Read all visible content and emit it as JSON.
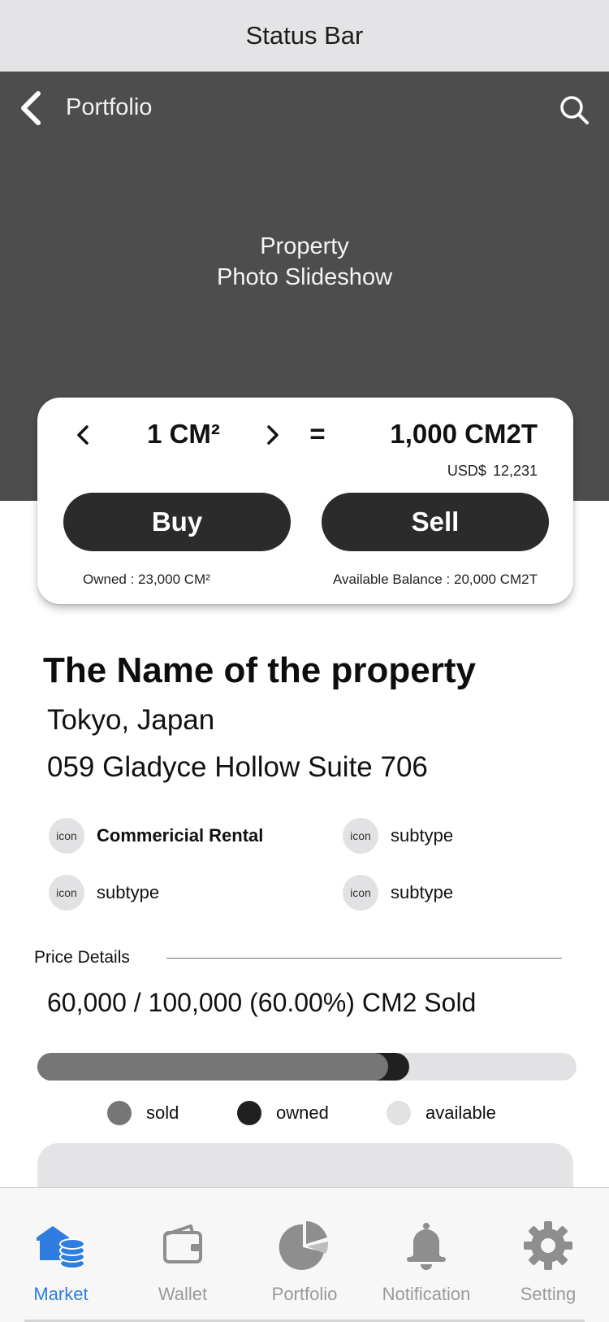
{
  "status_bar": {
    "label": "Status Bar"
  },
  "nav": {
    "title": "Portfolio",
    "back_icon": "chevron-left-icon",
    "search_icon": "search-icon"
  },
  "hero": {
    "line1": "Property",
    "line2": "Photo Slideshow"
  },
  "trade": {
    "quantity": "1 CM²",
    "equals": "=",
    "token_amount": "1,000 CM2T",
    "usd_label": "USD$",
    "usd_value": "12,231",
    "buy_label": "Buy",
    "sell_label": "Sell",
    "owned": "Owned : 23,000 CM²",
    "balance": "Available Balance : 20,000 CM2T"
  },
  "property": {
    "name": "The Name of the property",
    "city": "Tokyo, Japan",
    "address": "059 Gladyce Hollow Suite 706",
    "features": [
      {
        "icon": "icon",
        "label": "Commericial Rental"
      },
      {
        "icon": "icon",
        "label": "subtype"
      },
      {
        "icon": "icon",
        "label": "subtype"
      },
      {
        "icon": "icon",
        "label": "subtype"
      }
    ]
  },
  "price": {
    "header": "Price Details",
    "summary": "60,000 / 100,000 (60.00%) CM2 Sold",
    "sold_fraction": 0.65,
    "owned_fraction": 0.69
  },
  "legend": [
    {
      "label": "sold",
      "color": "#767676"
    },
    {
      "label": "owned",
      "color": "#202020"
    },
    {
      "label": "available",
      "color": "#e2e2e4"
    }
  ],
  "tabs": [
    {
      "label": "Market",
      "icon": "market-icon",
      "active": true
    },
    {
      "label": "Wallet",
      "icon": "wallet-icon",
      "active": false
    },
    {
      "label": "Portfolio",
      "icon": "pie-chart-icon",
      "active": false
    },
    {
      "label": "Notification",
      "icon": "bell-icon",
      "active": false
    },
    {
      "label": "Setting",
      "icon": "gear-icon",
      "active": false
    }
  ],
  "colors": {
    "accent": "#2f7de0",
    "hero_bg": "#4d4d4d",
    "button_bg": "#2b2b2b",
    "tab_inactive": "#9a9a9a"
  }
}
